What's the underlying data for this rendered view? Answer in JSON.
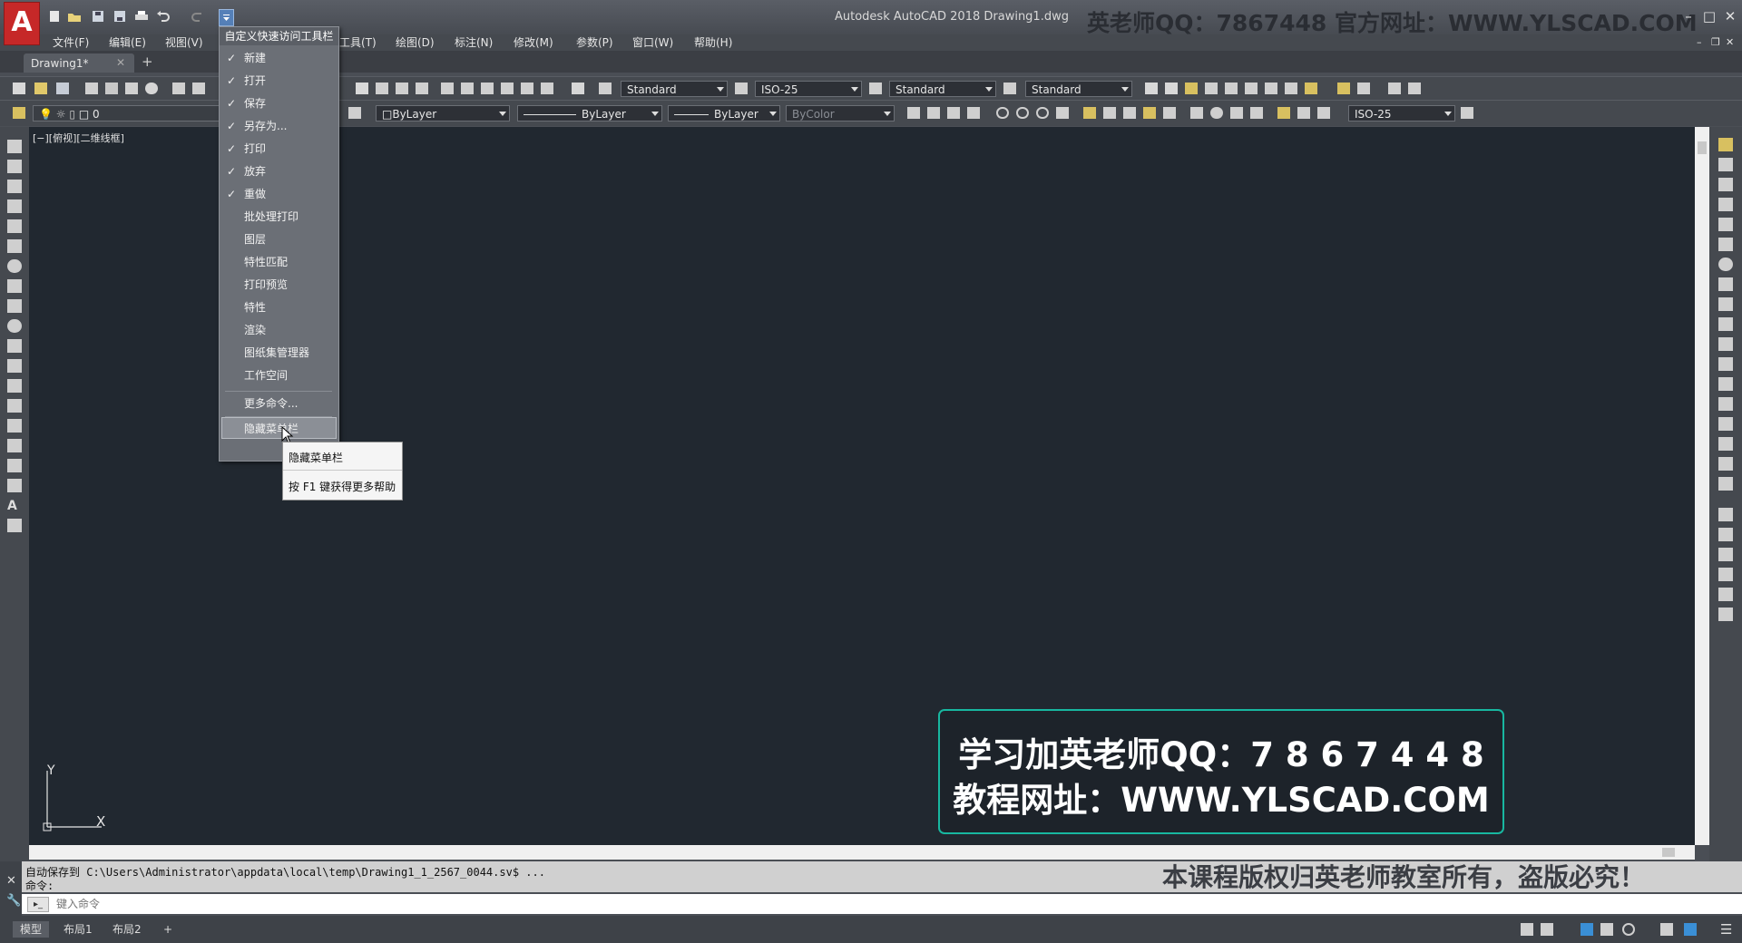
{
  "app": {
    "title": "Autodesk AutoCAD 2018    Drawing1.dwg",
    "logo": "A",
    "watermark_top": "英老师QQ：7867448  官方网址：WWW.YLSCAD.COM"
  },
  "menu": {
    "items": [
      "文件(F)",
      "编辑(E)",
      "视图(V)",
      "工具(T)",
      "绘图(D)",
      "标注(N)",
      "修改(M)",
      "参数(P)",
      "窗口(W)",
      "帮助(H)"
    ]
  },
  "tabs": {
    "doc": "Drawing1*",
    "add": "+"
  },
  "toolbar": {
    "text_style": "Standard",
    "dim_style": "ISO-25",
    "table_style": "Standard",
    "mleader_style": "Standard",
    "layer": "0",
    "color": "ByLayer",
    "linetype": "ByLayer",
    "lineweight": "ByLayer",
    "plotstyle": "ByColor",
    "dim_style2": "ISO-25"
  },
  "viewport": {
    "label": "[−][俯视][二维线框]",
    "ucs_x": "X",
    "ucs_y": "Y"
  },
  "qat_menu": {
    "header": "自定义快速访问工具栏",
    "items": [
      {
        "label": "新建",
        "check": "✓"
      },
      {
        "label": "打开",
        "check": "✓"
      },
      {
        "label": "保存",
        "check": "✓"
      },
      {
        "label": "另存为...",
        "check": "✓"
      },
      {
        "label": "打印",
        "check": "✓"
      },
      {
        "label": "放弃",
        "check": "✓"
      },
      {
        "label": "重做",
        "check": "✓"
      },
      {
        "label": "批处理打印",
        "check": ""
      },
      {
        "label": "图层",
        "check": ""
      },
      {
        "label": "特性匹配",
        "check": ""
      },
      {
        "label": "打印预览",
        "check": ""
      },
      {
        "label": "特性",
        "check": ""
      },
      {
        "label": "渲染",
        "check": ""
      },
      {
        "label": "图纸集管理器",
        "check": ""
      },
      {
        "label": "工作空间",
        "check": ""
      }
    ],
    "more": "更多命令...",
    "hide_menubar": "隐藏菜单栏"
  },
  "tooltip": {
    "title": "隐藏菜单栏",
    "help": "按 F1 键获得更多帮助"
  },
  "command": {
    "history1": "自动保存到 C:\\Users\\Administrator\\appdata\\local\\temp\\Drawing1_1_2567_0044.sv$ ...",
    "history2": "命令:",
    "placeholder": "键入命令"
  },
  "status": {
    "tabs": [
      "模型",
      "布局1",
      "布局2"
    ],
    "add": "+"
  },
  "watermark": {
    "line1": "学习加英老师QQ：7 8 6 7 4 4 8",
    "line2": "教程网址：WWW.YLSCAD.COM",
    "bottom": "本课程版权归英老师教室所有，盗版必究！"
  },
  "colors": {
    "canvas": "#212830",
    "accent_teal": "#18b7a0",
    "logo_red": "#c62828"
  }
}
